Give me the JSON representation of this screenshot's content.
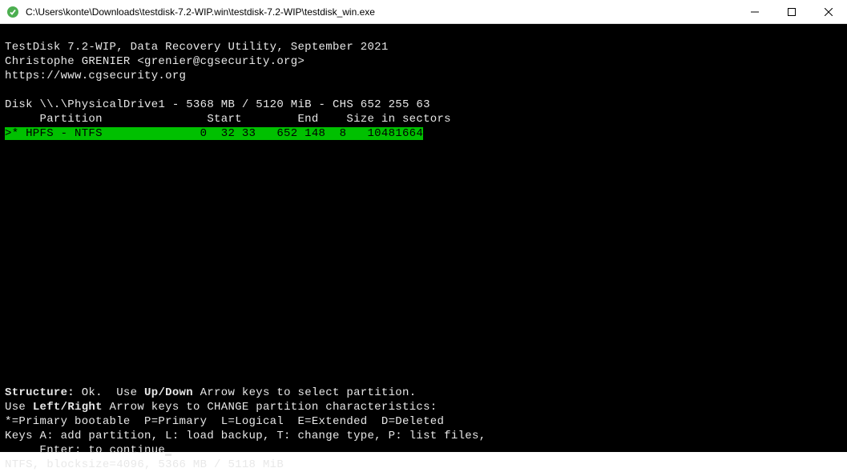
{
  "window": {
    "title": "C:\\Users\\konte\\Downloads\\testdisk-7.2-WIP.win\\testdisk-7.2-WIP\\testdisk_win.exe"
  },
  "header": {
    "line1": "TestDisk 7.2-WIP, Data Recovery Utility, September 2021",
    "line2": "Christophe GRENIER <grenier@cgsecurity.org>",
    "line3": "https://www.cgsecurity.org"
  },
  "disk": {
    "info": "Disk \\\\.\\PhysicalDrive1 - 5368 MB / 5120 MiB - CHS 652 255 63",
    "columns": "     Partition               Start        End    Size in sectors"
  },
  "partition": {
    "row": ">* HPFS - NTFS              0  32 33   652 148  8   10481664"
  },
  "footer": {
    "structure_a": "Structure: ",
    "structure_b": "Ok.",
    "structure_c": "  Use ",
    "structure_d": "Up/Down",
    "structure_e": " Arrow keys to select partition.",
    "lr_a": "Use ",
    "lr_b": "Left/Right",
    "lr_c": " Arrow keys to CHANGE partition characteristics:",
    "legend": "*=Primary bootable  P=Primary  L=Logical  E=Extended  D=Deleted",
    "keys": "Keys A: add partition, L: load backup, T: change type, P: list files,",
    "enter": "     Enter: to continue",
    "status": "NTFS, blocksize=4096, 5366 MB / 5118 MiB"
  }
}
